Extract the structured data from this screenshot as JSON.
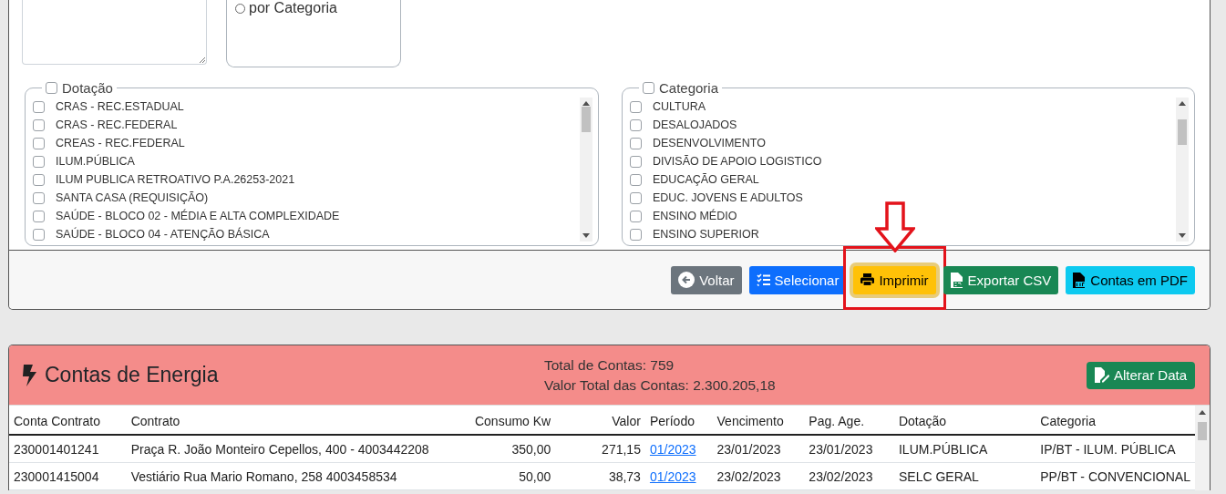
{
  "filters": {
    "grouping": {
      "options": [
        {
          "label": "por Categoria",
          "selected": false
        }
      ]
    },
    "lists": [
      {
        "legend": "Dotação",
        "checked": false,
        "items": [
          {
            "label": "CRAS - REC.ESTADUAL",
            "checked": false
          },
          {
            "label": "CRAS - REC.FEDERAL",
            "checked": false
          },
          {
            "label": "CREAS - REC.FEDERAL",
            "checked": false
          },
          {
            "label": "ILUM.PÚBLICA",
            "checked": false
          },
          {
            "label": "ILUM PUBLICA RETROATIVO P.A.26253-2021",
            "checked": false
          },
          {
            "label": "SANTA CASA (REQUISIÇÃO)",
            "checked": false
          },
          {
            "label": "SAÚDE - BLOCO 02 - MÉDIA E ALTA COMPLEXIDADE",
            "checked": false
          },
          {
            "label": "SAÚDE - BLOCO 04 - ATENÇÃO BÁSICA",
            "checked": false
          }
        ]
      },
      {
        "legend": "Categoria",
        "checked": false,
        "items": [
          {
            "label": "CULTURA",
            "checked": false
          },
          {
            "label": "DESALOJADOS",
            "checked": false
          },
          {
            "label": "DESENVOLVIMENTO",
            "checked": false
          },
          {
            "label": "DIVISÃO DE APOIO LOGISTICO",
            "checked": false
          },
          {
            "label": "EDUCAÇÃO GERAL",
            "checked": false
          },
          {
            "label": "EDUC. JOVENS E ADULTOS",
            "checked": false
          },
          {
            "label": "ENSINO MÉDIO",
            "checked": false
          },
          {
            "label": "ENSINO SUPERIOR",
            "checked": false
          }
        ]
      }
    ]
  },
  "actions": [
    {
      "label": "Voltar",
      "kind": "back",
      "highlighted": false
    },
    {
      "label": "Selecionar",
      "kind": "select",
      "highlighted": false
    },
    {
      "label": "Imprimir",
      "kind": "print",
      "highlighted": true
    },
    {
      "label": "Exportar CSV",
      "kind": "csv",
      "highlighted": false
    },
    {
      "label": "Contas em PDF",
      "kind": "pdf",
      "highlighted": false
    }
  ],
  "accounts": {
    "title": "Contas de Energia",
    "total_count": "Total de Contas: 759",
    "total_value": "Valor Total das Contas: 2.300.205,18",
    "action": "Alterar Data",
    "columns": [
      {
        "label": "Conta Contrato",
        "kind": "text"
      },
      {
        "label": "Contrato",
        "kind": "text"
      },
      {
        "label": "Consumo Kw",
        "kind": "number"
      },
      {
        "label": "Valor",
        "kind": "number"
      },
      {
        "label": "Período",
        "kind": "link"
      },
      {
        "label": "Vencimento",
        "kind": "text"
      },
      {
        "label": "Pag. Age.",
        "kind": "text"
      },
      {
        "label": "Dotação",
        "kind": "text"
      },
      {
        "label": "Categoria",
        "kind": "text"
      }
    ],
    "rows": [
      [
        "230001401241",
        "Praça R. João Monteiro Cepellos, 400 - 4003442208",
        "350,00",
        "271,15",
        "01/2023",
        "23/01/2023",
        "23/01/2023",
        "ILUM.PÚBLICA",
        "IP/BT - ILUM. PÚBLICA"
      ],
      [
        "230001415004",
        "Vestiário Rua Mario Romano, 258 4003458534",
        "50,00",
        "38,73",
        "01/2023",
        "23/02/2023",
        "23/02/2023",
        "SELC GERAL",
        "PP/BT - CONVENCIONAL"
      ]
    ]
  }
}
